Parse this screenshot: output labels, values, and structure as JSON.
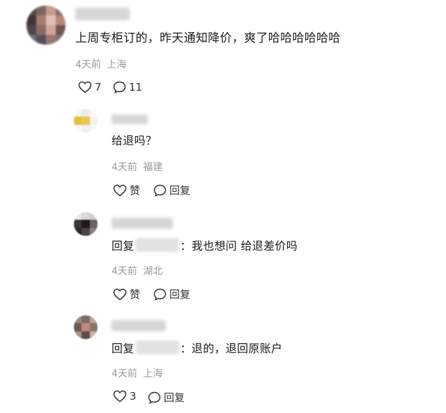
{
  "comment": {
    "text": "上周专柜订的，昨天通知降价，爽了哈哈哈哈哈哈",
    "time": "4天前",
    "location": "上海",
    "likes": "7",
    "replies": "11"
  },
  "replies": [
    {
      "text": "给退吗？",
      "time": "4天前",
      "location": "福建",
      "like_label": "赞",
      "reply_label": "回复"
    },
    {
      "reply_prefix": "回复",
      "text": "：我也想问 给退差价吗",
      "time": "4天前",
      "location": "湖北",
      "like_label": "赞",
      "reply_label": "回复"
    },
    {
      "reply_prefix": "回复",
      "text": "：退的，退回原账户",
      "time": "4天前",
      "location": "上海",
      "likes": "3",
      "reply_label": "回复"
    }
  ],
  "icons": {
    "like": "heart-outline-icon",
    "reply": "speech-bubble-icon"
  },
  "colors": {
    "meta_text": "#9a9a9a",
    "main_text": "#1a1a1a",
    "action_text": "#333333"
  }
}
